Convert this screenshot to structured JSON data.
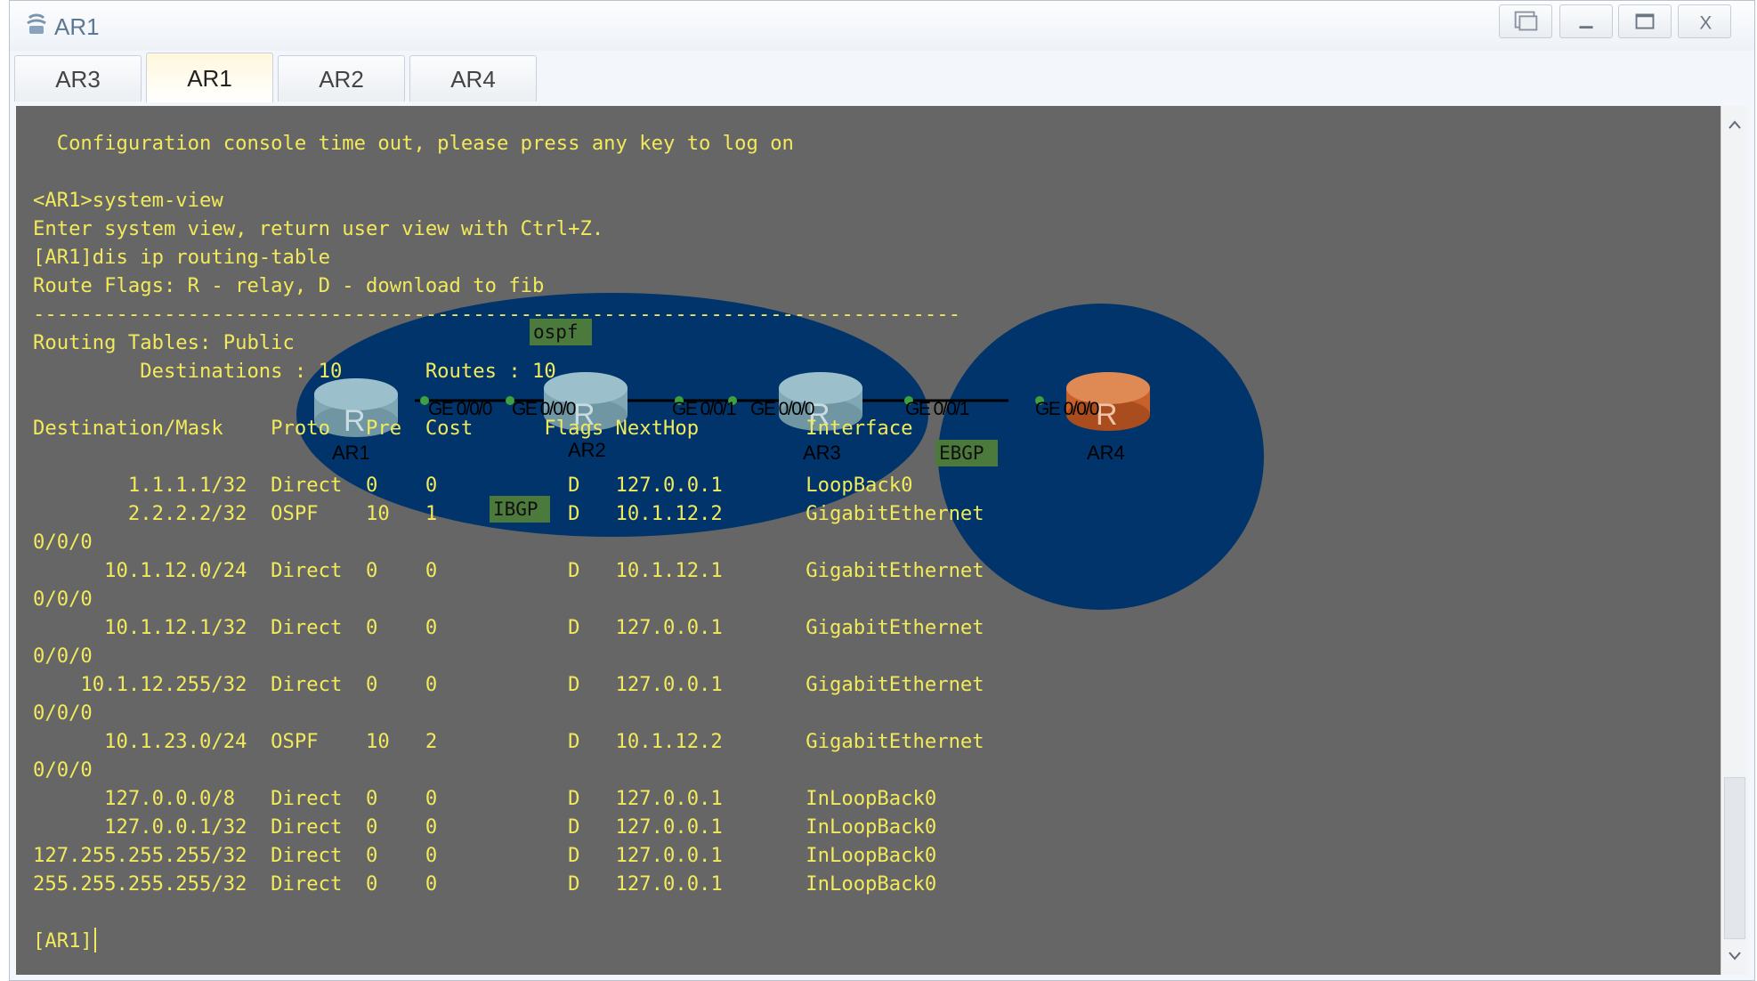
{
  "window": {
    "title": "AR1",
    "controls": {
      "restore": "restore-icon",
      "minimize": "minimize-icon",
      "maximize": "maximize-icon",
      "close": "X"
    }
  },
  "tabs": [
    {
      "label": "AR3",
      "active": false
    },
    {
      "label": "AR1",
      "active": true
    },
    {
      "label": "AR2",
      "active": false
    },
    {
      "label": "AR4",
      "active": false
    }
  ],
  "console": {
    "lines": [
      "  Configuration console time out, please press any key to log on",
      "",
      "<AR1>system-view",
      "Enter system view, return user view with Ctrl+Z.",
      "[AR1]dis ip routing-table",
      "Route Flags: R - relay, D - download to fib",
      "------------------------------------------------------------------------------",
      "Routing Tables: Public",
      "         Destinations : 10       Routes : 10",
      "",
      "Destination/Mask    Proto   Pre  Cost      Flags NextHop         Interface",
      "",
      "        1.1.1.1/32  Direct  0    0           D   127.0.0.1       LoopBack0",
      "        2.2.2.2/32  OSPF    10   1           D   10.1.12.2       GigabitEthernet",
      "0/0/0",
      "      10.1.12.0/24  Direct  0    0           D   10.1.12.1       GigabitEthernet",
      "0/0/0",
      "      10.1.12.1/32  Direct  0    0           D   127.0.0.1       GigabitEthernet",
      "0/0/0",
      "    10.1.12.255/32  Direct  0    0           D   127.0.0.1       GigabitEthernet",
      "0/0/0",
      "      10.1.23.0/24  OSPF    10   2           D   10.1.12.2       GigabitEthernet",
      "0/0/0",
      "      127.0.0.0/8   Direct  0    0           D   127.0.0.1       InLoopBack0",
      "      127.0.0.1/32  Direct  0    0           D   127.0.0.1       InLoopBack0",
      "127.255.255.255/32  Direct  0    0           D   127.0.0.1       InLoopBack0",
      "255.255.255.255/32  Direct  0    0           D   127.0.0.1       InLoopBack0",
      ""
    ],
    "prompt": "[AR1]"
  },
  "topology": {
    "routers": [
      "AR1",
      "AR2",
      "AR3",
      "AR4"
    ],
    "router_glyph": "R",
    "interfaces": [
      "GE 0/0/0",
      "GE 0/0/0",
      "GE 0/0/1",
      "GE 0/0/0",
      "GE 0/0/1",
      "GE 0/0/0"
    ],
    "tags": {
      "ospf": "ospf",
      "ibgp": "IBGP",
      "ebgp": "EBGP"
    },
    "colors": {
      "region": "#00346b",
      "router_blue": "#7fa8b4",
      "router_orange": "#c8602a",
      "tag": "#4c7a3c",
      "text": "#f2ea5c",
      "background": "#666666"
    }
  }
}
